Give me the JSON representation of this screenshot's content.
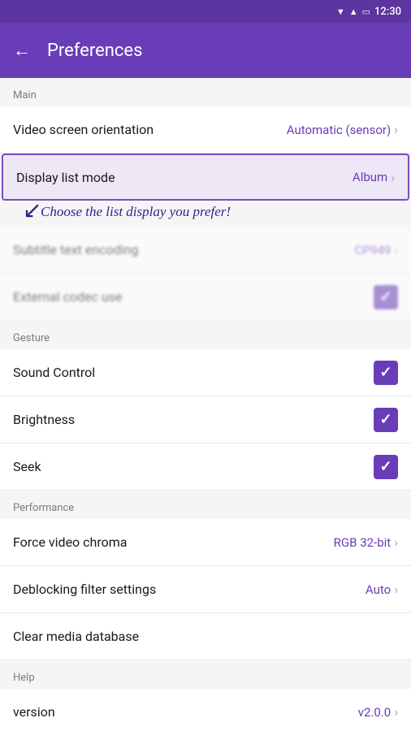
{
  "statusBar": {
    "time": "12:30",
    "wifiIcon": "▼",
    "signalIcon": "▲",
    "batteryIcon": "🔋"
  },
  "toolbar": {
    "backIcon": "←",
    "title": "Preferences"
  },
  "sections": {
    "main": {
      "label": "Main",
      "rows": [
        {
          "id": "video-screen-orientation",
          "label": "Video screen orientation",
          "value": "Automatic (sensor)",
          "type": "navigate"
        },
        {
          "id": "display-list-mode",
          "label": "Display list mode",
          "value": "Album",
          "type": "navigate",
          "highlighted": true
        },
        {
          "id": "subtitle-text-encoding",
          "label": "Subtitle text encoding",
          "value": "CP949",
          "type": "navigate",
          "blurred": true
        },
        {
          "id": "external-codec-use",
          "label": "External codec use",
          "value": null,
          "type": "checkbox",
          "checked": true,
          "blurred": true
        }
      ]
    },
    "gesture": {
      "label": "Gesture",
      "rows": [
        {
          "id": "sound-control",
          "label": "Sound Control",
          "value": null,
          "type": "checkbox",
          "checked": true
        },
        {
          "id": "brightness",
          "label": "Brightness",
          "value": null,
          "type": "checkbox",
          "checked": true
        },
        {
          "id": "seek",
          "label": "Seek",
          "value": null,
          "type": "checkbox",
          "checked": true
        }
      ]
    },
    "performance": {
      "label": "Performance",
      "rows": [
        {
          "id": "force-video-chroma",
          "label": "Force video chroma",
          "value": "RGB 32-bit",
          "type": "navigate"
        },
        {
          "id": "deblocking-filter-settings",
          "label": "Deblocking filter settings",
          "value": "Auto",
          "type": "navigate"
        },
        {
          "id": "clear-media-database",
          "label": "Clear media database",
          "value": null,
          "type": "action"
        }
      ]
    },
    "help": {
      "label": "Help",
      "rows": [
        {
          "id": "version",
          "label": "version",
          "value": "v2.0.0",
          "type": "navigate"
        }
      ]
    }
  },
  "tooltip": {
    "text": "Choose the list display you prefer!"
  }
}
